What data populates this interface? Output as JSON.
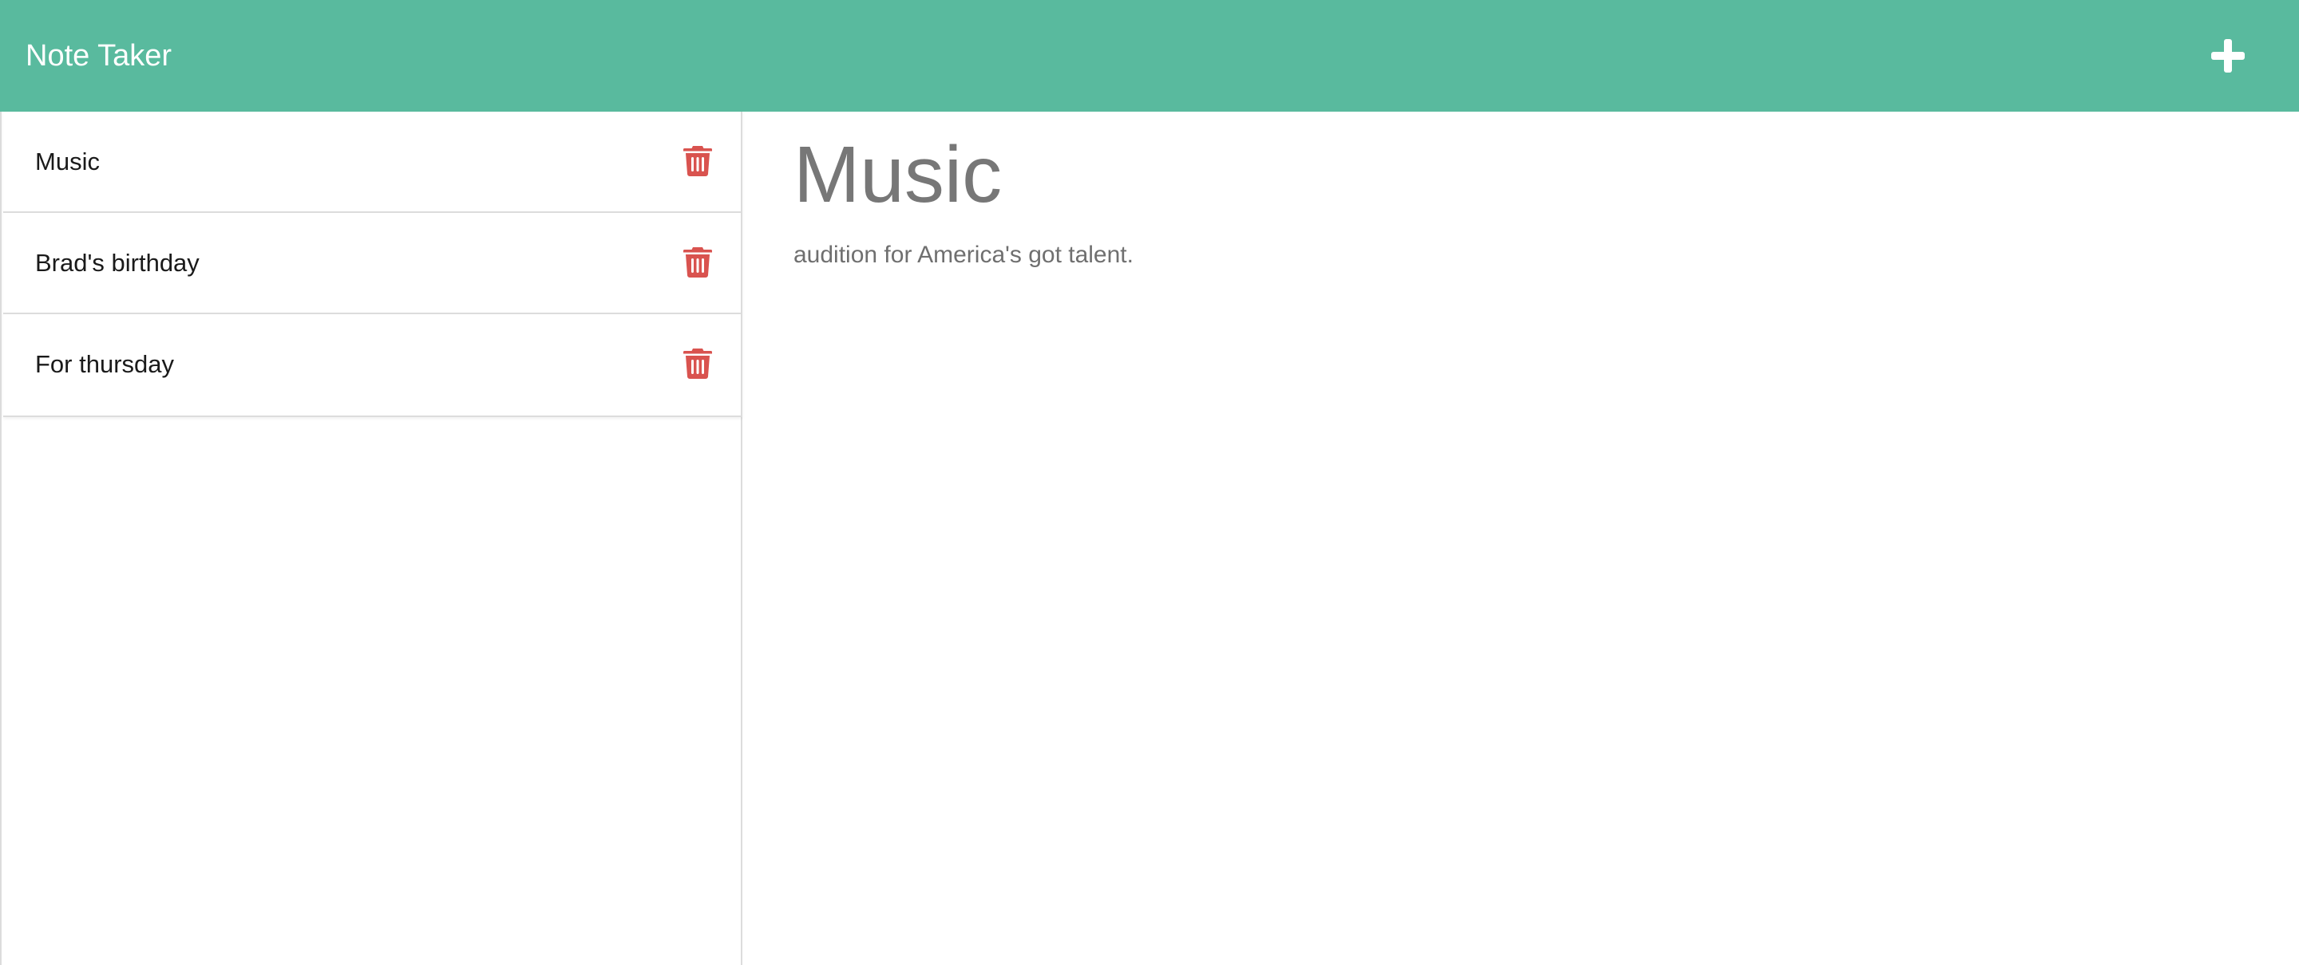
{
  "navbar": {
    "brand": "Note Taker",
    "new_note_icon": "plus-icon",
    "background": "#59ba9e"
  },
  "notes": [
    {
      "title": "Music",
      "delete_icon": "trash-icon"
    },
    {
      "title": "Brad's birthday",
      "delete_icon": "trash-icon"
    },
    {
      "title": "For thursday",
      "delete_icon": "trash-icon"
    }
  ],
  "active_note": {
    "title": "Music",
    "text": "audition for America's got talent."
  },
  "colors": {
    "accent": "#59ba9e",
    "delete": "#d9534f",
    "heading_text": "#777777"
  }
}
